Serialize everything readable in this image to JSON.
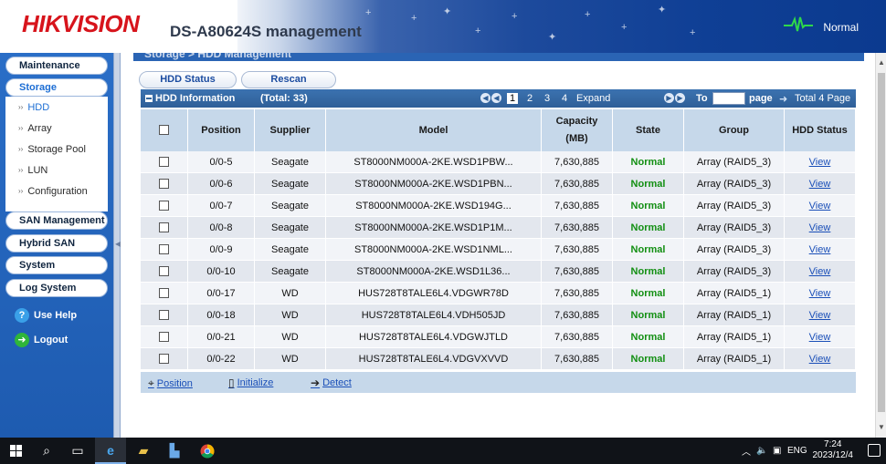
{
  "header": {
    "logo": "HIKVISION",
    "title": "DS-A80624S management",
    "status": "Normal",
    "pulse_icon": "heartbeat-icon",
    "accent_color": "#0f3f95",
    "logo_color": "#d7141c"
  },
  "sidebar": {
    "menus": [
      {
        "label": "Maintenance"
      },
      {
        "label": "Storage"
      },
      {
        "label": "SAN Management"
      },
      {
        "label": "Hybrid SAN"
      },
      {
        "label": "System"
      },
      {
        "label": "Log System"
      }
    ],
    "storage_items": [
      {
        "label": "HDD"
      },
      {
        "label": "Array"
      },
      {
        "label": "Storage Pool"
      },
      {
        "label": "LUN"
      },
      {
        "label": "Configuration"
      }
    ],
    "use_help": "Use Help",
    "logout": "Logout"
  },
  "main": {
    "breadcrumb": "Storage > HDD Management",
    "buttons": {
      "hdd_status": "HDD Status",
      "rescan": "Rescan"
    },
    "info_bar": {
      "title": "HDD Information",
      "total": "(Total: 33)",
      "pages": [
        "1",
        "2",
        "3",
        "4"
      ],
      "current_page": "1",
      "expand": "Expand",
      "to_label": "To",
      "page_label": "page",
      "total_pages": "Total 4 Page"
    },
    "columns": {
      "position": "Position",
      "supplier": "Supplier",
      "model": "Model",
      "capacity": "Capacity",
      "capacity_unit": "(MB)",
      "state": "State",
      "group": "Group",
      "hdd_status": "HDD Status"
    },
    "rows": [
      {
        "position": "0/0-5",
        "supplier": "Seagate",
        "model": "ST8000NM000A-2KE.WSD1PBW...",
        "capacity": "7,630,885",
        "state": "Normal",
        "group": "Array (RAID5_3)",
        "action": "View"
      },
      {
        "position": "0/0-6",
        "supplier": "Seagate",
        "model": "ST8000NM000A-2KE.WSD1PBN...",
        "capacity": "7,630,885",
        "state": "Normal",
        "group": "Array (RAID5_3)",
        "action": "View"
      },
      {
        "position": "0/0-7",
        "supplier": "Seagate",
        "model": "ST8000NM000A-2KE.WSD194G...",
        "capacity": "7,630,885",
        "state": "Normal",
        "group": "Array (RAID5_3)",
        "action": "View"
      },
      {
        "position": "0/0-8",
        "supplier": "Seagate",
        "model": "ST8000NM000A-2KE.WSD1P1M...",
        "capacity": "7,630,885",
        "state": "Normal",
        "group": "Array (RAID5_3)",
        "action": "View"
      },
      {
        "position": "0/0-9",
        "supplier": "Seagate",
        "model": "ST8000NM000A-2KE.WSD1NML...",
        "capacity": "7,630,885",
        "state": "Normal",
        "group": "Array (RAID5_3)",
        "action": "View"
      },
      {
        "position": "0/0-10",
        "supplier": "Seagate",
        "model": "ST8000NM000A-2KE.WSD1L36...",
        "capacity": "7,630,885",
        "state": "Normal",
        "group": "Array (RAID5_3)",
        "action": "View"
      },
      {
        "position": "0/0-17",
        "supplier": "WD",
        "model": "HUS728T8TALE6L4.VDGWR78D",
        "capacity": "7,630,885",
        "state": "Normal",
        "group": "Array (RAID5_1)",
        "action": "View"
      },
      {
        "position": "0/0-18",
        "supplier": "WD",
        "model": "HUS728T8TALE6L4.VDH505JD",
        "capacity": "7,630,885",
        "state": "Normal",
        "group": "Array (RAID5_1)",
        "action": "View"
      },
      {
        "position": "0/0-21",
        "supplier": "WD",
        "model": "HUS728T8TALE6L4.VDGWJTLD",
        "capacity": "7,630,885",
        "state": "Normal",
        "group": "Array (RAID5_1)",
        "action": "View"
      },
      {
        "position": "0/0-22",
        "supplier": "WD",
        "model": "HUS728T8TALE6L4.VDGVXVVD",
        "capacity": "7,630,885",
        "state": "Normal",
        "group": "Array (RAID5_1)",
        "action": "View"
      }
    ],
    "footer_actions": {
      "position": "Position",
      "initialize": "Initialize",
      "detect": "Detect"
    },
    "state_color": "#128f12"
  },
  "taskbar": {
    "language": "ENG",
    "time": "7:24",
    "date": "2023/12/4"
  }
}
